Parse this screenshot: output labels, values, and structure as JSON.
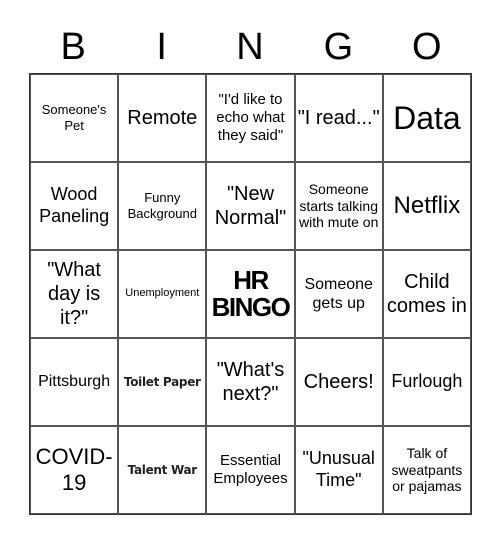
{
  "header": [
    "B",
    "I",
    "N",
    "G",
    "O"
  ],
  "cells": [
    "Someone's Pet",
    "Remote",
    "\"I'd like to echo what they said\"",
    "\"I read...\"",
    "Data",
    "Wood Paneling",
    "Funny Background",
    "\"New Normal\"",
    "Someone starts talking with mute on",
    "Netflix",
    "\"What day is it?\"",
    "Unemployment",
    "HR BINGO",
    "Someone gets up",
    "Child comes in",
    "Pittsburgh",
    "Toilet Paper",
    "\"What's next?\"",
    "Cheers!",
    "Furlough",
    "COVID-19",
    "Talent War",
    "Essential Employees",
    "\"Unusual Time\"",
    "Talk of sweatpants or pajamas"
  ]
}
